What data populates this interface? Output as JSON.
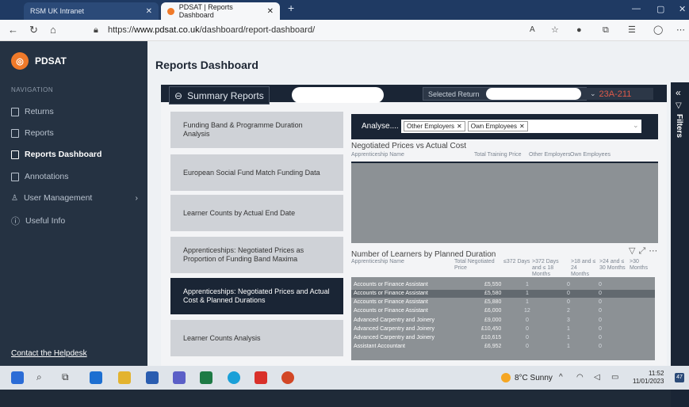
{
  "browser": {
    "tabs": [
      {
        "label": "RSM UK Intranet"
      },
      {
        "label": "PDSAT | Reports Dashboard"
      }
    ],
    "url_prefix": "https://",
    "url_host": "www.pdsat.co.uk",
    "url_path": "/dashboard/report-dashboard/"
  },
  "sidebar": {
    "brand": "PDSAT",
    "nav_heading": "NAVIGATION",
    "items": [
      {
        "label": "Returns"
      },
      {
        "label": "Reports"
      },
      {
        "label": "Reports Dashboard"
      },
      {
        "label": "Annotations"
      },
      {
        "label": "User Management"
      },
      {
        "label": "Useful Info"
      }
    ],
    "help_link": "Contact the Helpdesk"
  },
  "main": {
    "title": "Reports Dashboard",
    "summary_button": "Summary Reports",
    "selected_return_label": "Selected Return",
    "selected_return_value": "23A-211",
    "filters_label": "Filters",
    "report_cards": [
      {
        "label": "Funding Band & Programme Duration Analysis",
        "active": false
      },
      {
        "label": "European Social Fund Match Funding Data",
        "active": false
      },
      {
        "label": "Learner Counts by Actual End Date",
        "active": false
      },
      {
        "label": "Apprenticeships: Negotiated Prices as Proportion of Funding Band Maxima",
        "active": false
      },
      {
        "label": "Apprenticeships: Negotiated Prices and Actual Cost & Planned Durations",
        "active": true
      },
      {
        "label": "Learner Counts Analysis",
        "active": false
      }
    ],
    "analyse": {
      "label": "Analyse....",
      "chips": [
        "Other Employers",
        "Own Employees"
      ]
    },
    "neg_prices": {
      "title": "Negotiated Prices vs Actual Cost",
      "col_name": "Apprenticeship Name",
      "col_total": "Total Training Price",
      "col_other": "Other Employers",
      "col_own": "Own Employees"
    },
    "learners": {
      "title": "Number of Learners by Planned Duration",
      "headers": [
        "Apprenticeship Name",
        "Total Negotiated Price",
        "≤372 Days",
        ">372 Days and ≤ 18 Months",
        ">18 and ≤ 24 Months",
        ">24 and ≤ 30 Months",
        ">30 Months"
      ],
      "rows": [
        {
          "name": "Accounts or Finance Assistant",
          "price": "£5,550",
          "a": "1",
          "b": "0",
          "c": "0"
        },
        {
          "name": "Accounts or Finance Assistant",
          "price": "£5,580",
          "a": "1",
          "b": "0",
          "c": "0"
        },
        {
          "name": "Accounts or Finance Assistant",
          "price": "£5,880",
          "a": "1",
          "b": "0",
          "c": "0"
        },
        {
          "name": "Accounts or Finance Assistant",
          "price": "£6,000",
          "a": "12",
          "b": "2",
          "c": "0"
        },
        {
          "name": "Advanced Carpentry and Joinery",
          "price": "£9,000",
          "a": "0",
          "b": "3",
          "c": "0"
        },
        {
          "name": "Advanced Carpentry and Joinery",
          "price": "£10,450",
          "a": "0",
          "b": "1",
          "c": "0"
        },
        {
          "name": "Advanced Carpentry and Joinery",
          "price": "£10,615",
          "a": "0",
          "b": "1",
          "c": "0"
        },
        {
          "name": "Assistant Accountant",
          "price": "£6,952",
          "a": "0",
          "b": "1",
          "c": "0"
        }
      ]
    }
  },
  "taskbar": {
    "weather": "8°C Sunny",
    "time": "11:52",
    "date": "11/01/2023",
    "notifications": "47"
  }
}
